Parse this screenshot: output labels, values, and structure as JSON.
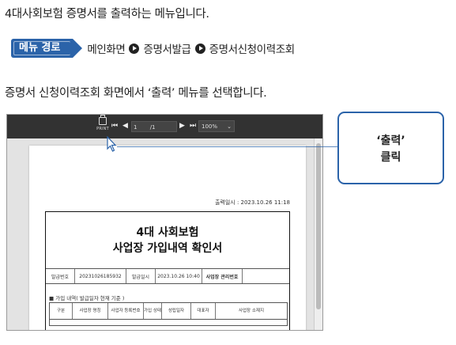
{
  "intro_text": "4대사회보험 증명서를 출력하는 메뉴입니다.",
  "menu_path": {
    "badge_label": "메뉴 경로",
    "crumbs": [
      "메인화면",
      "증명서발급",
      "증명서신청이력조회"
    ]
  },
  "instruction_text": "증명서 신청이력조회 화면에서 ‘출력’ 메뉴를 선택합니다.",
  "viewer": {
    "print_label": "PRINT",
    "current_page": "1",
    "total_pages": "/1",
    "zoom": "100%",
    "print_date": "출력일시 : 2023.10.26 11:18",
    "doc_title_line1": "4대 사회보험",
    "doc_title_line2": "사업장 가입내역 확인서",
    "info_row": [
      "발급번호",
      "20231026185932",
      "발급일시",
      "2023.10.26 10:40",
      "사업장 관리번호",
      ""
    ],
    "section_label": "■ 가입 내역( 발급일자 현재 기준 )",
    "columns": [
      "구분",
      "사업장 명칭",
      "사업자 등록번호",
      "가입 상태",
      "성립일자",
      "대표자",
      "사업장 소재지"
    ]
  },
  "callout": {
    "line1": "‘출력’",
    "line2": "클릭"
  },
  "colors": {
    "accent_blue": "#2b63a9",
    "toolbar_bg": "#323232"
  }
}
